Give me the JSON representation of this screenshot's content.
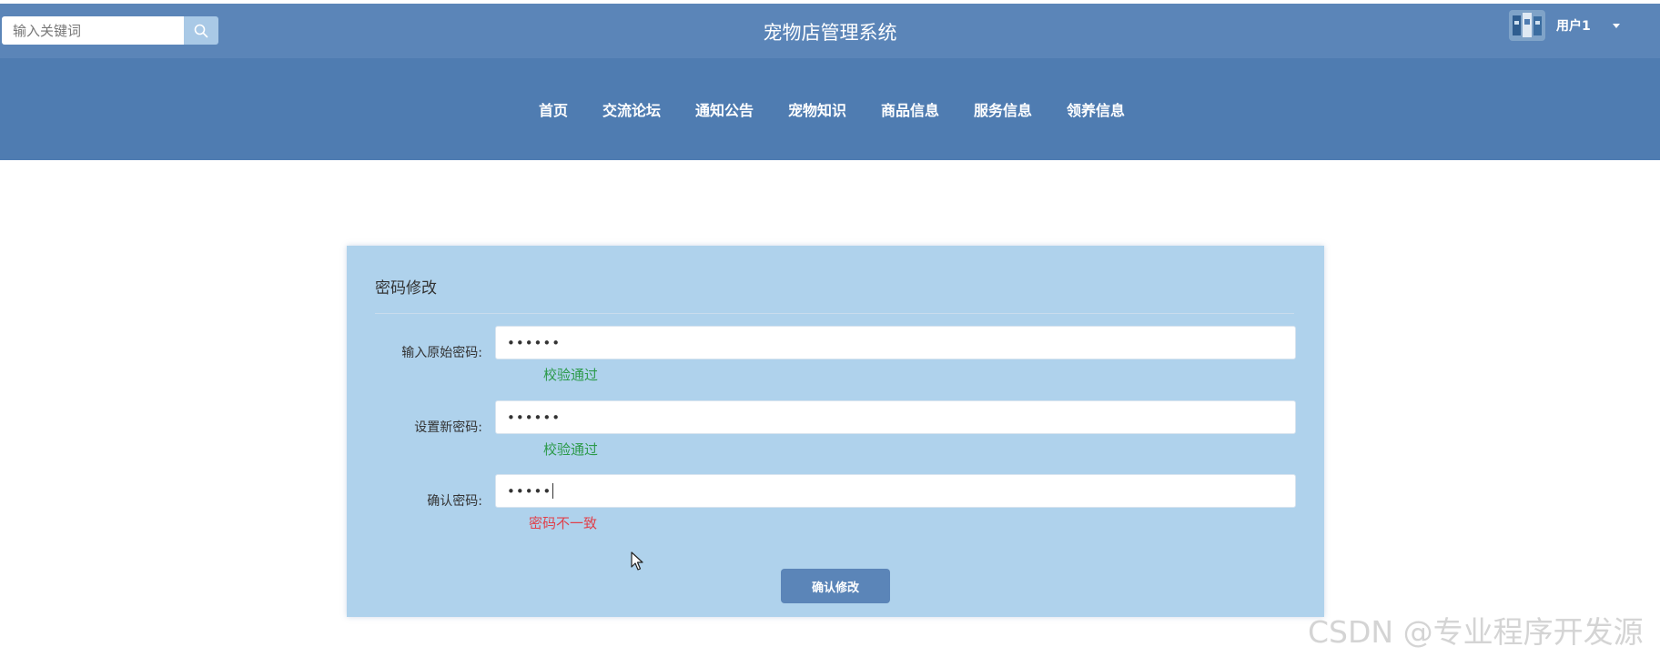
{
  "header": {
    "title": "宠物店管理系统",
    "search_placeholder": "输入关键词",
    "search_icon": "search-icon",
    "user_name": "用户1",
    "avatar_icon": "avatar-image"
  },
  "nav": {
    "items": [
      {
        "label": "首页"
      },
      {
        "label": "交流论坛"
      },
      {
        "label": "通知公告"
      },
      {
        "label": "宠物知识"
      },
      {
        "label": "商品信息"
      },
      {
        "label": "服务信息"
      },
      {
        "label": "领养信息"
      }
    ]
  },
  "form": {
    "title": "密码修改",
    "fields": [
      {
        "label": "输入原始密码:",
        "value": "••••••",
        "hint": "校验通过",
        "hint_status": "ok"
      },
      {
        "label": "设置新密码:",
        "value": "••••••",
        "hint": "校验通过",
        "hint_status": "ok"
      },
      {
        "label": "确认密码:",
        "value": "•••••",
        "hint": "密码不一致",
        "hint_status": "error"
      }
    ],
    "submit_label": "确认修改"
  },
  "watermark": "CSDN @专业程序开发源",
  "colors": {
    "header_bg": "#5b85b8",
    "nav_bg": "#4f7cb1",
    "panel_bg": "#afd2ec",
    "ok": "#2c9a4a",
    "error": "#e0404a"
  }
}
